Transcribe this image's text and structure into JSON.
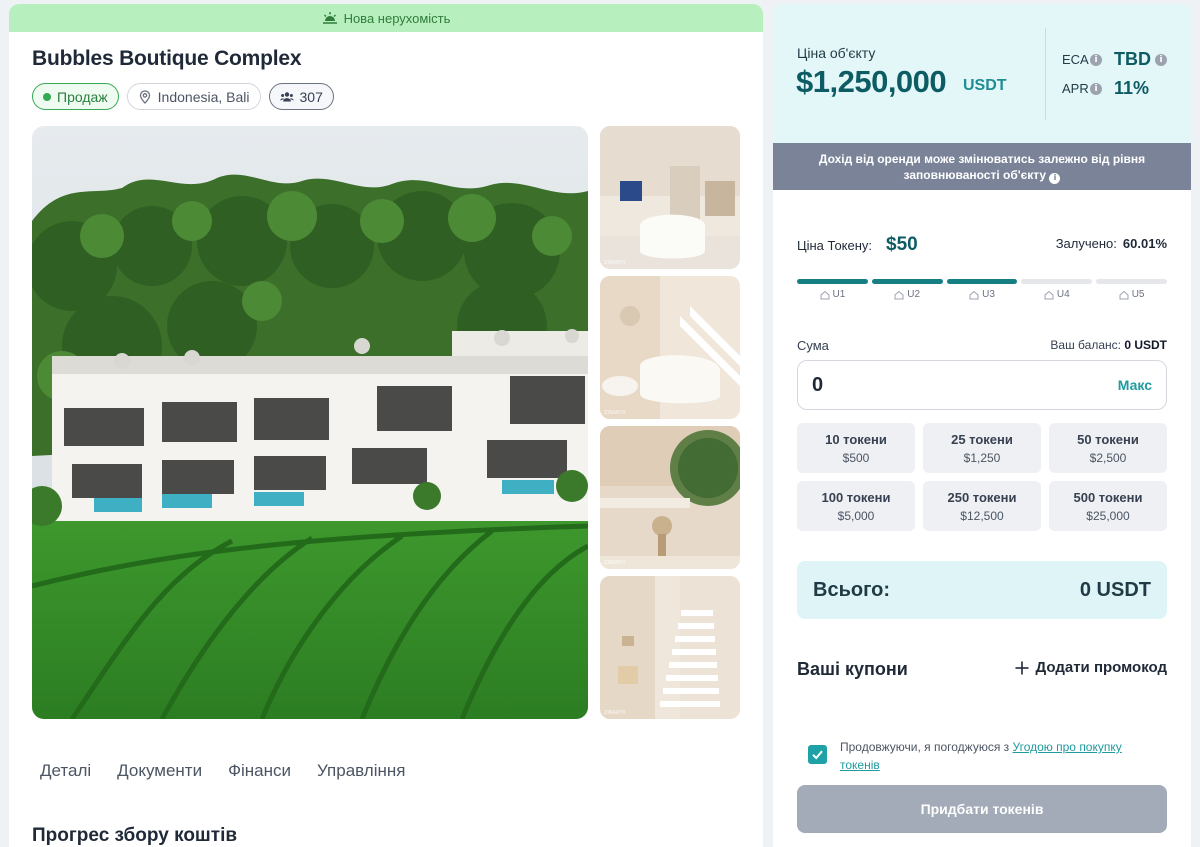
{
  "listing": {
    "banner": "Нова нерухомість",
    "title": "Bubbles Boutique Complex",
    "status_chip": "Продаж",
    "location": "Indonesia, Bali",
    "investors": "307"
  },
  "tabs": [
    "Деталі",
    "Документи",
    "Фінанси",
    "Управління"
  ],
  "section_heading": "Прогрес збору коштів",
  "price": {
    "label": "Ціна об'єкту",
    "value": "$1,250,000",
    "unit": "USDT",
    "eca_label": "ECA",
    "eca_value": "TBD",
    "apr_label": "APR",
    "apr_value": "11%"
  },
  "notice": {
    "line1": "Дохід від оренди може змінюватись залежно від рівня",
    "line2": "заповнюваності об'єкту"
  },
  "token": {
    "price_label": "Ціна Токену:",
    "price_value": "$50",
    "raised_label": "Залучено:",
    "raised_value": "60.01%",
    "raised_fraction": 0.6001
  },
  "stages": [
    {
      "label": "U1",
      "filled": true
    },
    {
      "label": "U2",
      "filled": true
    },
    {
      "label": "U3",
      "filled": true
    },
    {
      "label": "U4",
      "filled": false
    },
    {
      "label": "U5",
      "filled": false
    }
  ],
  "purchase": {
    "sum_label": "Сума",
    "balance_label": "Ваш баланс:",
    "balance_value": "0 USDT",
    "amount_value": "0",
    "max_label": "Макс",
    "presets": [
      {
        "tokens": "10 токени",
        "price": "$500"
      },
      {
        "tokens": "25 токени",
        "price": "$1,250"
      },
      {
        "tokens": "50 токени",
        "price": "$2,500"
      },
      {
        "tokens": "100 токени",
        "price": "$5,000"
      },
      {
        "tokens": "250 токени",
        "price": "$12,500"
      },
      {
        "tokens": "500 токени",
        "price": "$25,000"
      }
    ],
    "total_label": "Всього:",
    "total_value": "0 USDT",
    "coupons_title": "Ваші купони",
    "add_promo": "Додати промокод",
    "agree_text": "Продовжуючи, я погоджуюся з ",
    "agree_link": "Угодою про покупку токенів",
    "agree_checked": true,
    "buy_label": "Придбати токенів"
  },
  "colors": {
    "accent": "#157f83",
    "accent_light": "#1e9aa0",
    "banner_bg": "#b7efbf",
    "price_bg": "#e3f6f8",
    "notice_bg": "#7a8398",
    "buy_disabled": "#a3aab8"
  },
  "icons": {
    "banner": "sunrise-icon",
    "location": "map-pin-icon",
    "investors": "users-icon",
    "stage": "house-icon",
    "info": "info-icon",
    "add": "plus-icon",
    "check": "check-icon"
  }
}
